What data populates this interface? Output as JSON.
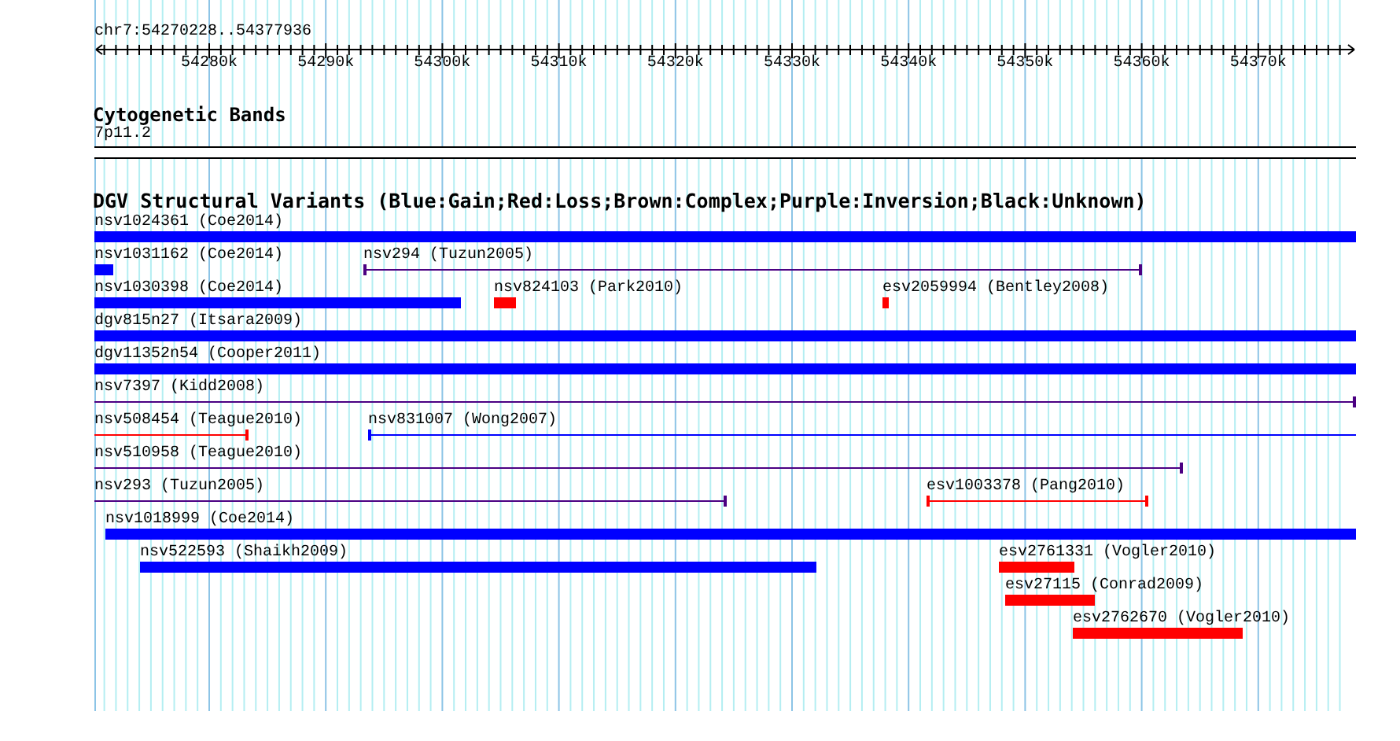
{
  "ruler": {
    "title": "chr7:54270228..54377936",
    "ticks": [
      "54280k",
      "54290k",
      "54300k",
      "54310k",
      "54320k",
      "54330k",
      "54340k",
      "54350k",
      "54360k",
      "54370k"
    ]
  },
  "tracks": [
    {
      "kind": "cytoband",
      "title": "Cytogenetic Bands",
      "bands": [
        {
          "label": "7p11.2"
        }
      ]
    },
    {
      "kind": "variants",
      "title": "DGV Structural Variants (Blue:Gain;Red:Loss;Brown:Complex;Purple:Inversion;Black:Unknown)",
      "features": [
        {
          "label": "nsv1024361 (Coe2014)",
          "kind": "bar",
          "color": "#0000ff"
        },
        {
          "label": "nsv1031162 (Coe2014)",
          "kind": "bar",
          "color": "#0000ff"
        },
        {
          "label": "nsv294 (Tuzun2005)",
          "kind": "line",
          "color": "#4b0082"
        },
        {
          "label": "nsv1030398 (Coe2014)",
          "kind": "bar",
          "color": "#0000ff"
        },
        {
          "label": "nsv824103 (Park2010)",
          "kind": "bar",
          "color": "#ff0000"
        },
        {
          "label": "esv2059994 (Bentley2008)",
          "kind": "bar",
          "color": "#ff0000"
        },
        {
          "label": "dgv815n27 (Itsara2009)",
          "kind": "bar",
          "color": "#0000ff"
        },
        {
          "label": "dgv11352n54 (Cooper2011)",
          "kind": "bar",
          "color": "#0000ff"
        },
        {
          "label": "nsv7397 (Kidd2008)",
          "kind": "line",
          "color": "#4b0082"
        },
        {
          "label": "nsv508454 (Teague2010)",
          "kind": "line",
          "color": "#ff0000"
        },
        {
          "label": "nsv831007 (Wong2007)",
          "kind": "line",
          "color": "#0000ff"
        },
        {
          "label": "nsv510958 (Teague2010)",
          "kind": "line",
          "color": "#4b0082"
        },
        {
          "label": "nsv293 (Tuzun2005)",
          "kind": "line",
          "color": "#4b0082"
        },
        {
          "label": "esv1003378 (Pang2010)",
          "kind": "line",
          "color": "#ff0000"
        },
        {
          "label": "nsv1018999 (Coe2014)",
          "kind": "bar",
          "color": "#0000ff"
        },
        {
          "label": "nsv522593 (Shaikh2009)",
          "kind": "bar",
          "color": "#0000ff"
        },
        {
          "label": "esv2761331 (Vogler2010)",
          "kind": "bar",
          "color": "#ff0000"
        },
        {
          "label": "esv27115 (Conrad2009)",
          "kind": "bar",
          "color": "#ff0000"
        },
        {
          "label": "esv2762670 (Vogler2010)",
          "kind": "bar",
          "color": "#ff0000"
        }
      ]
    }
  ]
}
